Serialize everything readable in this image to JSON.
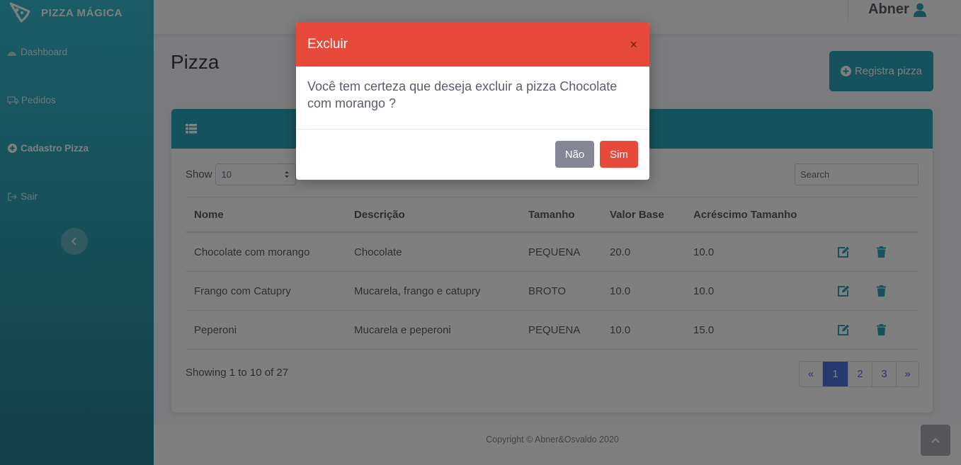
{
  "brand": {
    "name": "PIZZA MÁGICA",
    "icon": "pizza-slice-icon"
  },
  "sidebar": {
    "items": [
      {
        "label": "Dashboard",
        "icon": "dashboard-icon",
        "active": false
      },
      {
        "label": "Pedidos",
        "icon": "truck-icon",
        "active": false
      },
      {
        "label": "Cadastro Pizza",
        "icon": "plus-circle-icon",
        "active": true
      },
      {
        "label": "Sair",
        "icon": "sign-out-icon",
        "active": false
      }
    ],
    "collapse_icon": "chevron-left-icon"
  },
  "topbar": {
    "user_name": "Abner",
    "user_icon": "user-icon"
  },
  "page": {
    "title": "Pizza",
    "register_button": "Registra pizza"
  },
  "table_controls": {
    "show_label": "Show",
    "page_size": "10",
    "search_placeholder": "Search"
  },
  "table": {
    "headers": [
      "Nome",
      "Descrição",
      "Tamanho",
      "Valor Base",
      "Acréscimo Tamanho"
    ],
    "rows": [
      {
        "nome": "Chocolate com morango",
        "descricao": "Chocolate",
        "tamanho": "PEQUENA",
        "valor_base": "20.0",
        "acrescimo": "10.0"
      },
      {
        "nome": "Frango com Catupry",
        "descricao": "Mucarela, frango e catupry",
        "tamanho": "BROTO",
        "valor_base": "10.0",
        "acrescimo": "10.0"
      },
      {
        "nome": "Peperoni",
        "descricao": "Mucarela e peperoni",
        "tamanho": "PEQUENA",
        "valor_base": "10.0",
        "acrescimo": "15.0"
      }
    ]
  },
  "footer_info": {
    "showing": "Showing 1 to 10 of 27"
  },
  "pagination": {
    "prev": "«",
    "pages": [
      "1",
      "2",
      "3"
    ],
    "active": "1",
    "next": "»"
  },
  "footer": {
    "copyright": "Copyright © Abner&Osvaldo 2020"
  },
  "modal": {
    "title": "Excluir",
    "close": "×",
    "message": "Você tem certeza que deseja excluir a pizza Chocolate com morango ?",
    "no_label": "Não",
    "yes_label": "Sim"
  },
  "colors": {
    "primary": "#2aa5b7",
    "danger": "#e74a3b",
    "secondary": "#858796",
    "pagination_active": "#4e73df"
  }
}
